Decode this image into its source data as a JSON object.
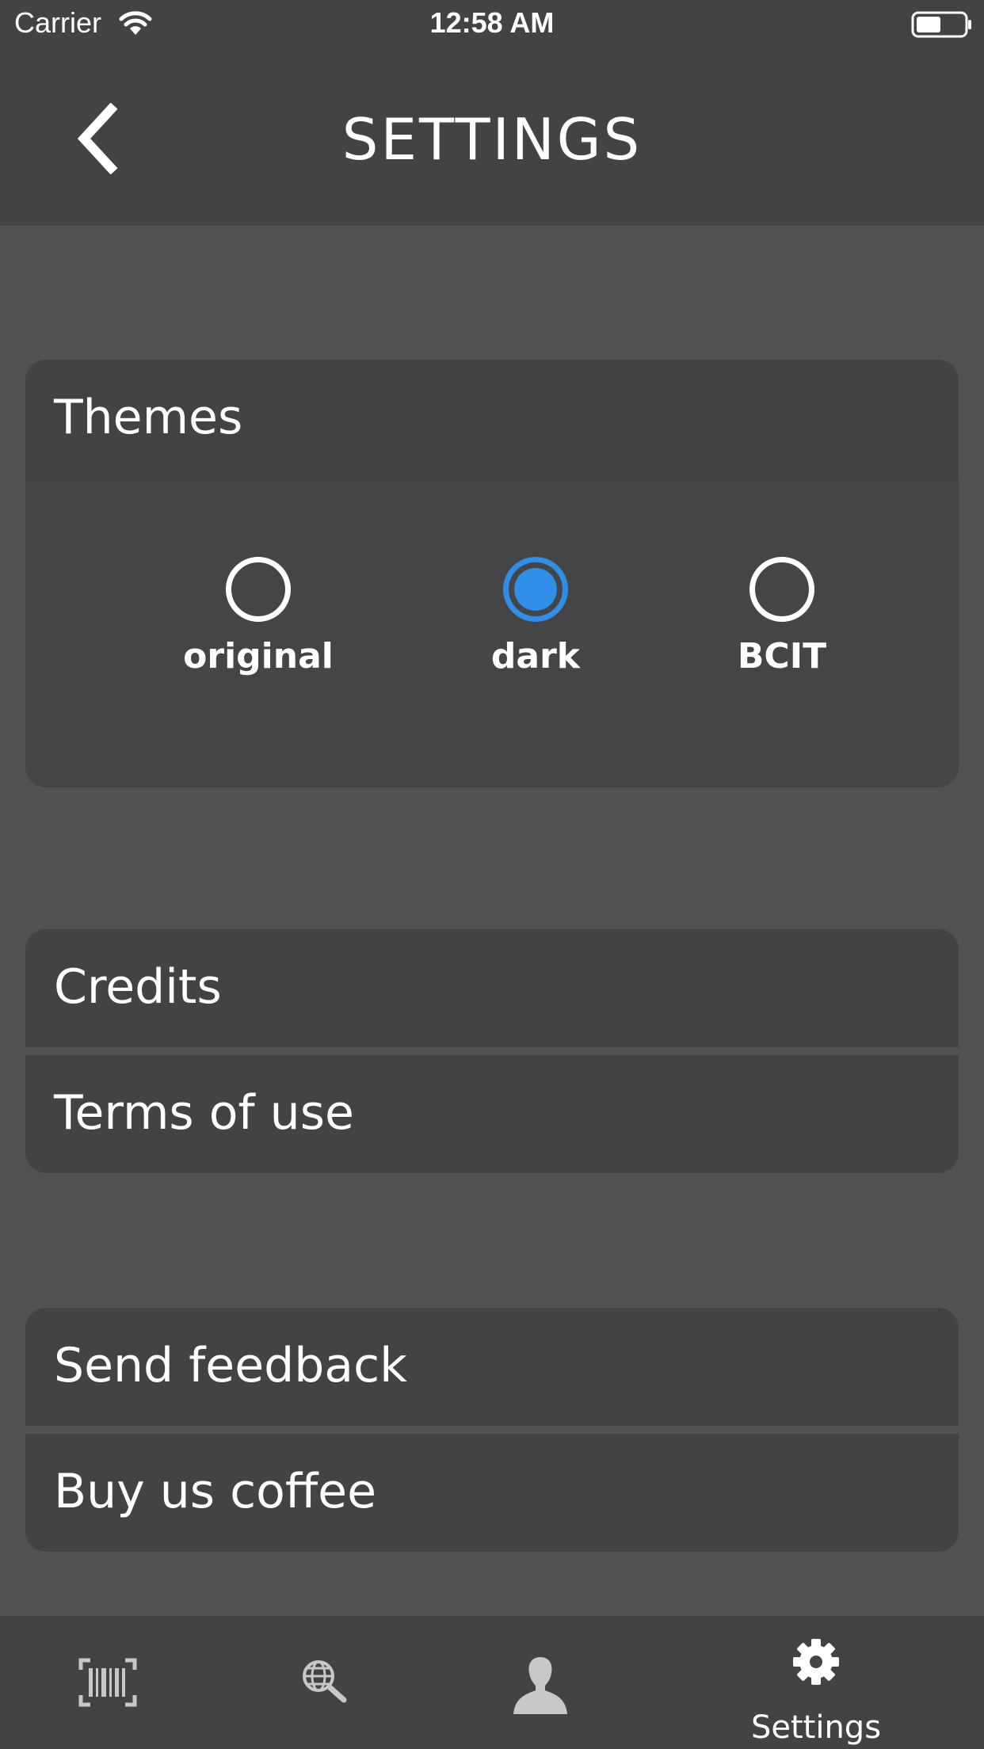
{
  "status_bar": {
    "carrier": "Carrier",
    "time": "12:58 AM"
  },
  "header": {
    "title": "SETTINGS"
  },
  "themes": {
    "heading": "Themes",
    "options": [
      {
        "label": "original",
        "selected": false
      },
      {
        "label": "dark",
        "selected": true
      },
      {
        "label": "BCIT",
        "selected": false
      }
    ],
    "accent_color": "#2e8ee8"
  },
  "info_menu": {
    "credits": "Credits",
    "terms": "Terms of use"
  },
  "support_menu": {
    "feedback": "Send feedback",
    "coffee": "Buy us coffee"
  },
  "tab_bar": {
    "tabs": [
      {
        "icon": "barcode-scan-icon",
        "label": ""
      },
      {
        "icon": "globe-search-icon",
        "label": ""
      },
      {
        "icon": "profile-icon",
        "label": ""
      },
      {
        "icon": "gear-icon",
        "label": "Settings",
        "active": true
      }
    ]
  }
}
